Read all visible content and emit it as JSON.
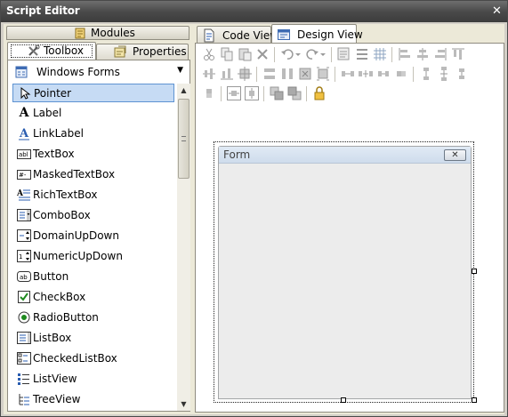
{
  "window": {
    "title": "Script Editor",
    "close_glyph": "✕"
  },
  "left_panel": {
    "tabs": {
      "modules": "Modules",
      "toolbox": "Toolbox",
      "properties": "Properties"
    },
    "category": "Windows Forms",
    "items": [
      {
        "label": "Pointer",
        "icon": "pointer-icon",
        "selected": true
      },
      {
        "label": "Label",
        "icon": "label-icon"
      },
      {
        "label": "LinkLabel",
        "icon": "linklabel-icon"
      },
      {
        "label": "TextBox",
        "icon": "textbox-icon"
      },
      {
        "label": "MaskedTextBox",
        "icon": "maskedtextbox-icon"
      },
      {
        "label": "RichTextBox",
        "icon": "richtextbox-icon"
      },
      {
        "label": "ComboBox",
        "icon": "combobox-icon"
      },
      {
        "label": "DomainUpDown",
        "icon": "domainupdown-icon"
      },
      {
        "label": "NumericUpDown",
        "icon": "numericupdown-icon"
      },
      {
        "label": "Button",
        "icon": "button-icon"
      },
      {
        "label": "CheckBox",
        "icon": "checkbox-icon"
      },
      {
        "label": "RadioButton",
        "icon": "radiobutton-icon"
      },
      {
        "label": "ListBox",
        "icon": "listbox-icon"
      },
      {
        "label": "CheckedListBox",
        "icon": "checkedlistbox-icon"
      },
      {
        "label": "ListView",
        "icon": "listview-icon"
      },
      {
        "label": "TreeView",
        "icon": "treeview-icon"
      }
    ]
  },
  "right_panel": {
    "tabs": {
      "code_view": "Code View",
      "design_view": "Design View"
    },
    "form": {
      "title": "Form",
      "close_glyph": "✕"
    }
  },
  "icon_glyphs": {
    "textbox": "abl",
    "button": "ab",
    "maskedtextbox": "#-",
    "label": "A"
  },
  "colors": {
    "selection": "#c6dbf4",
    "selection_border": "#5e93d2",
    "titlebar": "#4a4a4a",
    "panel": "#ece9d8"
  }
}
